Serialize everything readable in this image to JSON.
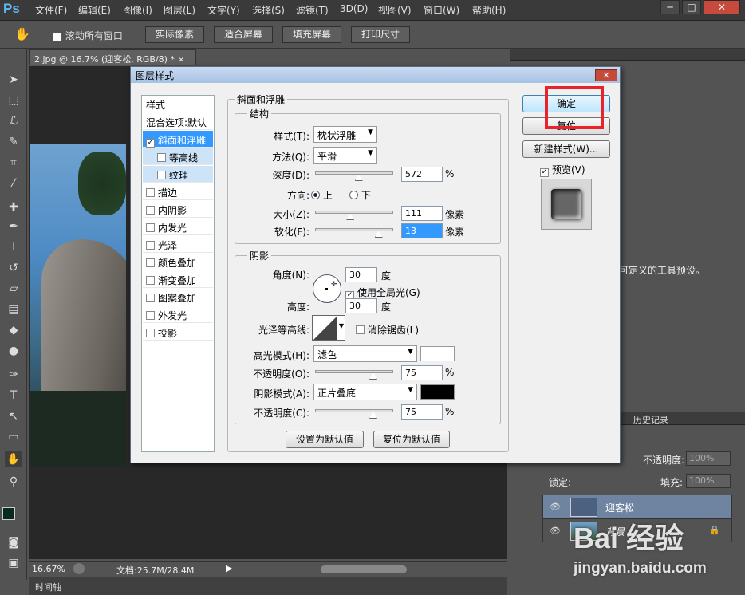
{
  "menubar": {
    "logo": "Ps",
    "items": [
      "文件(F)",
      "编辑(E)",
      "图像(I)",
      "图层(L)",
      "文字(Y)",
      "选择(S)",
      "滤镜(T)",
      "3D(D)",
      "视图(V)",
      "窗口(W)",
      "帮助(H)"
    ],
    "min": "─",
    "restore": "□",
    "close": "✕"
  },
  "options": {
    "scroll_all": "滚动所有窗口",
    "actual_pixels": "实际像素",
    "fit_screen": "适合屏幕",
    "fill_screen": "填充屏幕",
    "print_size": "打印尺寸"
  },
  "doc": {
    "tab": "2.jpg @ 16.7% (迎客松, RGB/8) *",
    "close": "×"
  },
  "status": {
    "zoom": "16.67%",
    "docsize": "文档:25.7M/28.4M"
  },
  "timeline": {
    "label": "时间轴"
  },
  "panels": {
    "history_tab": "历史记录",
    "tool_preset_text": "可定义的工具预设。",
    "opacity_label": "不透明度:",
    "opacity_value": "100%",
    "lock_label": "锁定:",
    "fill_label": "填充:",
    "fill_value": "100%",
    "layers": [
      {
        "name": "迎客松"
      },
      {
        "name": "背景"
      }
    ]
  },
  "dialog": {
    "title": "图层样式",
    "close": "✕",
    "style_header": "样式",
    "blend_default": "混合选项:默认",
    "styles": [
      {
        "label": "斜面和浮雕",
        "checked": true,
        "selected": true
      },
      {
        "label": "等高线",
        "checked": false,
        "sub": true
      },
      {
        "label": "纹理",
        "checked": false,
        "sub": true
      },
      {
        "label": "描边",
        "checked": false
      },
      {
        "label": "内阴影",
        "checked": false
      },
      {
        "label": "内发光",
        "checked": false
      },
      {
        "label": "光泽",
        "checked": false
      },
      {
        "label": "颜色叠加",
        "checked": false
      },
      {
        "label": "渐变叠加",
        "checked": false
      },
      {
        "label": "图案叠加",
        "checked": false
      },
      {
        "label": "外发光",
        "checked": false
      },
      {
        "label": "投影",
        "checked": false
      }
    ],
    "bevel_title": "斜面和浮雕",
    "structure_title": "结构",
    "style_label": "样式(T):",
    "style_value": "枕状浮雕",
    "technique_label": "方法(Q):",
    "technique_value": "平滑",
    "depth_label": "深度(D):",
    "depth_value": "572",
    "depth_unit": "%",
    "depth_level": 0.56,
    "direction_label": "方向:",
    "dir_up": "上",
    "dir_down": "下",
    "size_label": "大小(Z):",
    "size_value": "111",
    "size_unit": "像素",
    "size_level": 0.45,
    "soften_label": "软化(F):",
    "soften_value": "13",
    "soften_unit": "像素",
    "soften_level": 0.82,
    "shading_title": "阴影",
    "angle_label": "角度(N):",
    "angle_value": "30",
    "angle_unit": "度",
    "global_light": "使用全局光(G)",
    "altitude_label": "高度:",
    "altitude_value": "30",
    "altitude_unit": "度",
    "gloss_label": "光泽等高线:",
    "antialias": "消除锯齿(L)",
    "highlight_label": "高光模式(H):",
    "highlight_value": "滤色",
    "highlight_color": "#ffffff",
    "opacity1_label": "不透明度(O):",
    "opacity1_value": "75",
    "opacity_unit": "%",
    "opacity1_level": 0.75,
    "shadow_label": "阴影模式(A):",
    "shadow_value": "正片叠底",
    "shadow_color": "#000000",
    "opacity2_label": "不透明度(C):",
    "opacity2_value": "75",
    "opacity2_level": 0.75,
    "make_default": "设置为默认值",
    "reset_default": "复位为默认值",
    "ok": "确定",
    "reset": "复位",
    "new_style": "新建样式(W)...",
    "preview": "预览(V)"
  },
  "watermark": {
    "brand": "Bai 经验",
    "url": "jingyan.baidu.com"
  }
}
